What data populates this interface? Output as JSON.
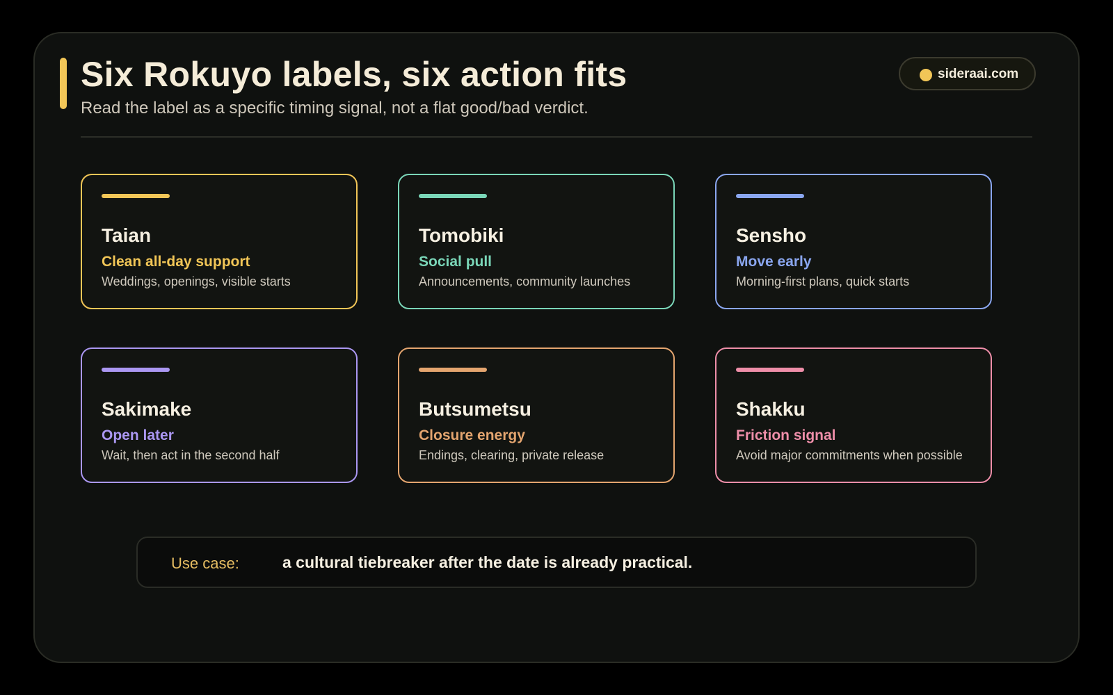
{
  "header": {
    "title": "Six Rokuyo labels, six action fits",
    "subtitle": "Read the label as a specific timing signal, not a flat good/bad verdict.",
    "accent_color": "#f2c657"
  },
  "badge": {
    "text": "sideraai.com",
    "dot_color": "#f2c657"
  },
  "cards": [
    {
      "name": "Taian",
      "action": "Clean all-day support",
      "desc": "Weddings, openings, visible starts",
      "color": "#f2c657"
    },
    {
      "name": "Tomobiki",
      "action": "Social pull",
      "desc": "Announcements, community launches",
      "color": "#7ad6b8"
    },
    {
      "name": "Sensho",
      "action": "Move early",
      "desc": "Morning-first plans, quick starts",
      "color": "#8aa6ef"
    },
    {
      "name": "Sakimake",
      "action": "Open later",
      "desc": "Wait, then act in the second half",
      "color": "#ab97f2"
    },
    {
      "name": "Butsumetsu",
      "action": "Closure energy",
      "desc": "Endings, clearing, private release",
      "color": "#e4a56f"
    },
    {
      "name": "Shakku",
      "action": "Friction signal",
      "desc": "Avoid major commitments when possible",
      "color": "#ee8ea9"
    }
  ],
  "footer": {
    "label": "Use case:",
    "text": "a cultural tiebreaker after the date is already practical.",
    "label_color": "#e6bd62"
  }
}
